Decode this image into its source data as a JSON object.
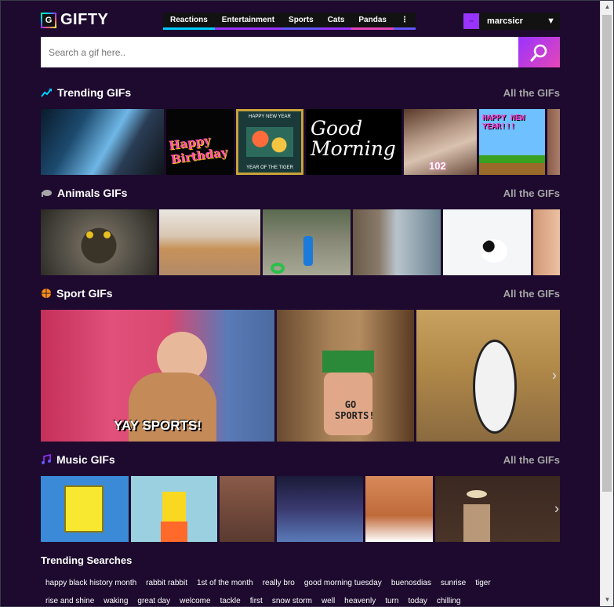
{
  "brand": {
    "logo_letter": "G",
    "name": "GIFTY"
  },
  "nav": [
    {
      "label": "Reactions",
      "color": "#00ccff"
    },
    {
      "label": "Entertainment",
      "color": "#9933ff"
    },
    {
      "label": "Sports",
      "color": "#6157ff"
    },
    {
      "label": "Cats",
      "color": "#9933ff"
    },
    {
      "label": "Pandas",
      "color": "#e646b6"
    },
    {
      "label": "⋮",
      "color": "#6157ff"
    }
  ],
  "user": {
    "name": "marcsicr",
    "avatar_text": "◦◦",
    "caret": "▼"
  },
  "search": {
    "placeholder": "Search a gif here.."
  },
  "sections": {
    "trending": {
      "title": "Trending GIFs",
      "link": "All the GIFs"
    },
    "animals": {
      "title": "Animals GIFs",
      "link": "All the GIFs"
    },
    "sport": {
      "title": "Sport GIFs",
      "link": "All the GIFs"
    },
    "music": {
      "title": "Music GIFs",
      "link": "All the GIFs"
    }
  },
  "gif_captions": {
    "birthday": "Happy Birthday",
    "newyear_top": "HAPPY NEW YEAR",
    "newyear_bottom": "YEAR OF THE TIGER",
    "good_morning": "Good Morning",
    "happy_new_year": "HAPPY NEW YEAR!!!",
    "cake": "102",
    "yay_sports": "YAY SPORTS!",
    "go_sports": "GO SPORTS!"
  },
  "trending_searches": {
    "title": "Trending Searches",
    "items": [
      "happy black history month",
      "rabbit rabbit",
      "1st of the month",
      "really bro",
      "good morning tuesday",
      "buenosdias",
      "sunrise",
      "tiger",
      "rise and shine",
      "waking",
      "great day",
      "welcome",
      "tackle",
      "first",
      "snow storm",
      "well",
      "heavenly",
      "turn",
      "today",
      "chilling"
    ]
  },
  "colors": {
    "background": "#1d0a2e",
    "accent": "#9933ff",
    "accent_pink": "#e646b6",
    "link_gray": "#a6a6a6"
  },
  "icons": {
    "trending": "trending-arrow-icon",
    "animals": "elephant-icon",
    "sport": "basketball-icon",
    "music": "music-note-icon",
    "search": "magnifier-icon",
    "next": "chevron-right-icon"
  }
}
